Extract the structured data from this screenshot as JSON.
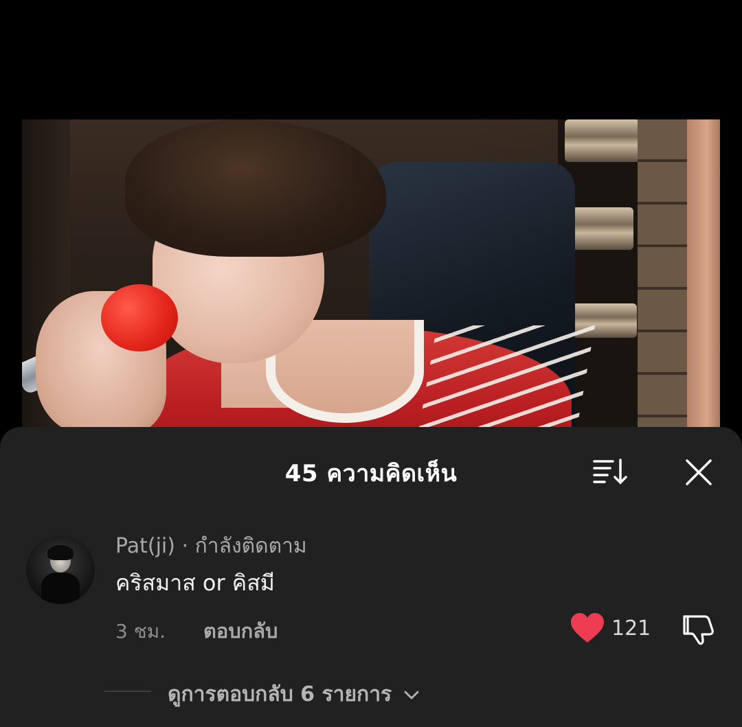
{
  "video": {
    "description_icon": "video-frame"
  },
  "comments_sheet": {
    "title": "45 ความคิดเห็น",
    "sort_icon": "sort-icon",
    "close_icon": "close-icon"
  },
  "comment": {
    "author": "Pat(ji) · กำลังติดตาม",
    "text": "คริสมาส or คิสมี",
    "time": "3 ชม.",
    "reply_label": "ตอบกลับ",
    "like_count": "121",
    "liked": true,
    "like_color": "#ee3c52",
    "view_replies_label": "ดูการตอบกลับ 6 รายการ"
  },
  "colors": {
    "sheet_background": "#212121",
    "page_background": "#000000",
    "heart": "#ee3c52"
  }
}
